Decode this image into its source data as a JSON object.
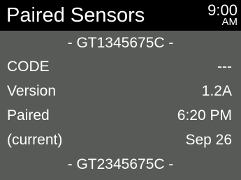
{
  "header": {
    "title": "Paired Sensors",
    "time": "9:00",
    "ampm": "AM"
  },
  "sensors": [
    {
      "name": "- GT1345675C -",
      "code_label": "CODE",
      "code_value": "---",
      "version_label": "Version",
      "version_value": "1.2A",
      "paired_label": "Paired",
      "paired_time": "6:20 PM",
      "status_label": "(current)",
      "paired_date": "Sep 26"
    },
    {
      "name": "- GT2345675C -"
    }
  ],
  "colors": {
    "header_bg": "#000000",
    "content_bg": "#585a58",
    "text": "#ffffff"
  }
}
